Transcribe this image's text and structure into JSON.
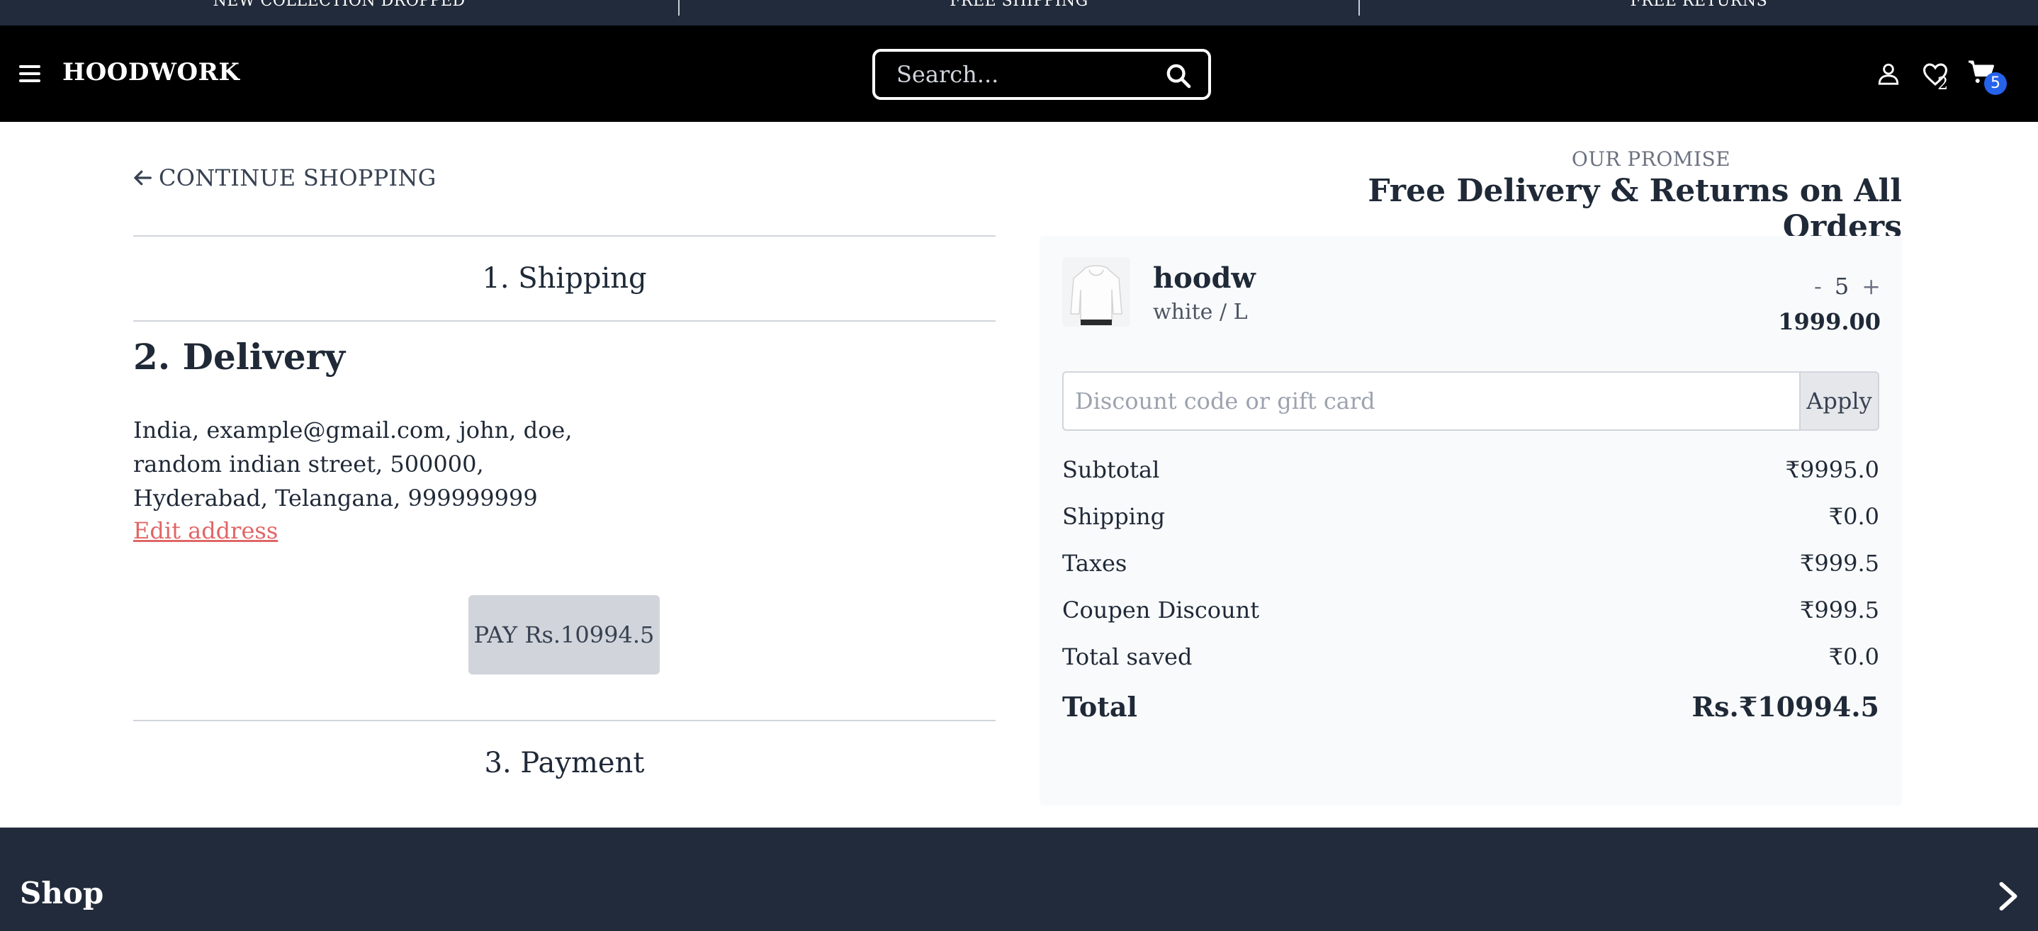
{
  "announcements": [
    "NEW COLLECTION DROPPED",
    "FREE SHIPPING",
    "FREE RETURNS"
  ],
  "header": {
    "brand": "HOODWORK",
    "search_placeholder": "Search...",
    "wishlist_count": "2",
    "cart_count": "5"
  },
  "checkout": {
    "continue_label": "CONTINUE SHOPPING",
    "step1": "1. Shipping",
    "step2": "2. Delivery",
    "address_lines": [
      "India, example@gmail.com, john, doe,",
      "random indian street, 500000,",
      "Hyderabad, Telangana, 999999999"
    ],
    "edit_address": "Edit address",
    "pay_label": "PAY Rs.10994.5",
    "step3": "3. Payment"
  },
  "promise": {
    "label": "OUR PROMISE",
    "title": "Free Delivery & Returns on All Orders"
  },
  "cart": {
    "item": {
      "name": "hoodw",
      "variant": "white / L",
      "qty": "5",
      "minus": "-",
      "plus": "+",
      "price": "1999.00"
    },
    "discount_placeholder": "Discount code or gift card",
    "apply_label": "Apply",
    "summary": [
      {
        "label": "Subtotal",
        "value": "₹9995.0"
      },
      {
        "label": "Shipping",
        "value": "₹0.0"
      },
      {
        "label": "Taxes",
        "value": "₹999.5"
      },
      {
        "label": "Coupen Discount",
        "value": "₹999.5"
      },
      {
        "label": "Total saved",
        "value": "₹0.0"
      }
    ],
    "total_label": "Total",
    "total_value": "Rs.₹10994.5"
  },
  "footer": {
    "title": "Shop"
  },
  "colors": {
    "topbar": "#222b3b",
    "header": "#000000",
    "link_red": "#e06666",
    "badge_blue": "#2563eb",
    "summary_bg": "#f9fafb"
  }
}
